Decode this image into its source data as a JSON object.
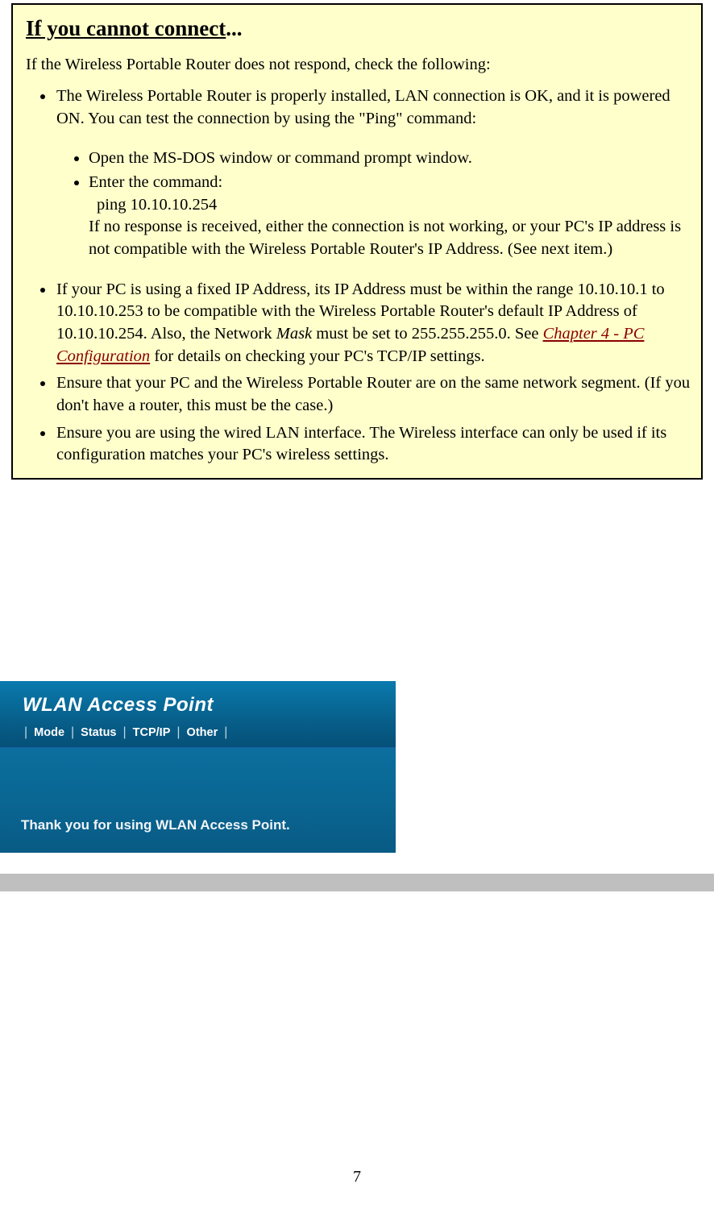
{
  "notice": {
    "title_underline": "If you cannot connect",
    "title_suffix": "...",
    "intro": "If the Wireless Portable Router does not respond, check the following:",
    "bullet1_text": "The Wireless Portable Router is properly installed, LAN connection is OK, and it is powered ON. You can test the connection by using the \"Ping\" command:",
    "sub1": "Open the MS-DOS window or command prompt window.",
    "sub2_line1": "Enter the command:",
    "sub2_ping": "ping 10.10.10.254",
    "sub2_rest": "If no response is received, either the connection is not working, or your PC's IP address is not compatible with the Wireless Portable Router's IP Address. (See next item.)",
    "bullet2_part1": "If your PC is using a fixed IP Address, its IP Address must be within the range 10.10.10.1 to 10.10.10.253 to be compatible with the Wireless Portable Router's default IP Address of 10.10.10.254. Also, the Network ",
    "bullet2_mask": "Mask",
    "bullet2_part2": " must be set to 255.255.255.0. See ",
    "bullet2_link": "Chapter 4 - PC Configuration",
    "bullet2_part3": " for details on checking your PC's TCP/IP settings.",
    "bullet3": "Ensure that your PC and the Wireless Portable Router are on the same network segment. (If you don't have a router, this must be the case.)",
    "bullet4": "Ensure you are using the wired LAN interface. The Wireless interface can only be used if its configuration matches your PC's wireless settings."
  },
  "wlan": {
    "title": "WLAN Access Point",
    "tabs": [
      "Mode",
      "Status",
      "TCP/IP",
      "Other"
    ],
    "message": "Thank you for using WLAN Access Point."
  },
  "page_number": "7"
}
